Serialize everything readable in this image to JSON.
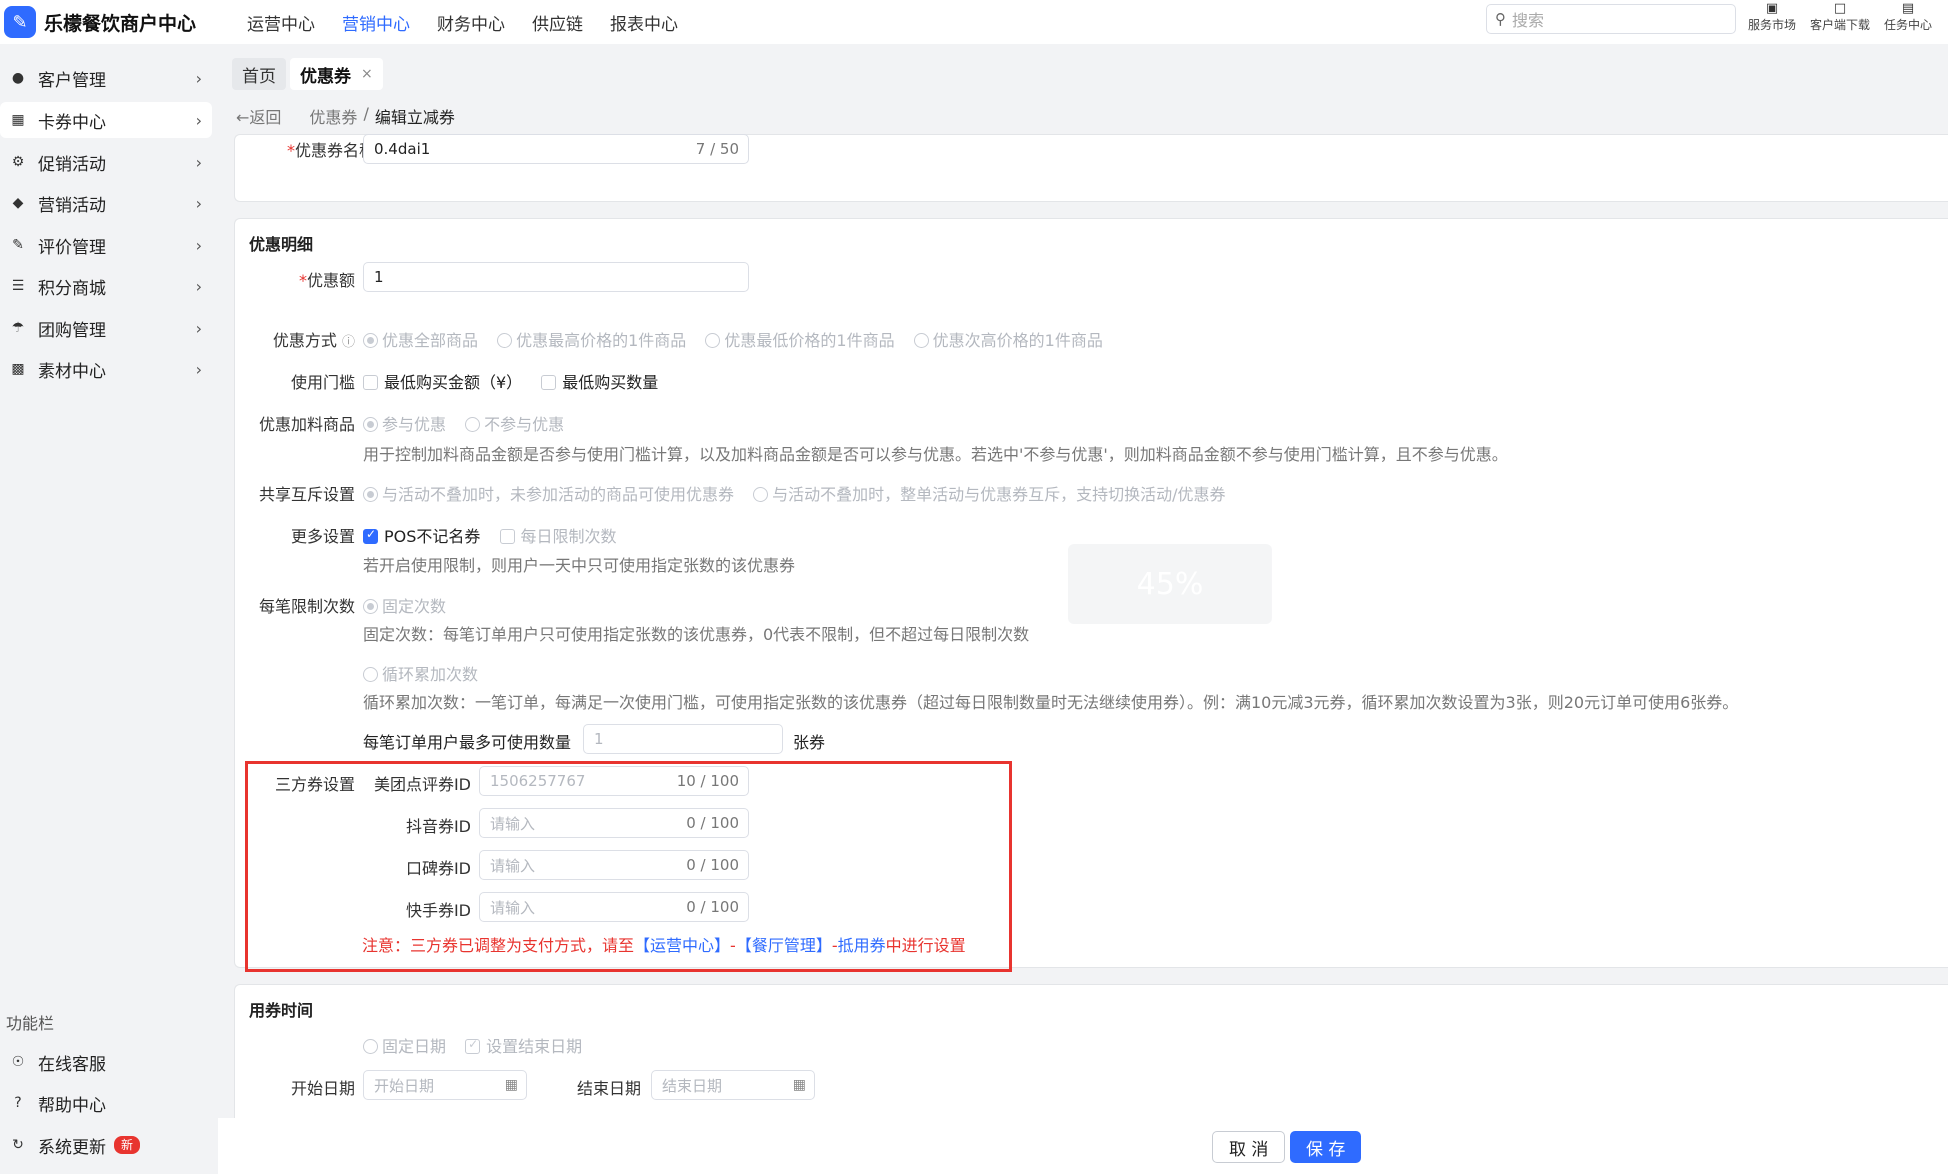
{
  "app": {
    "logo_glyph": "✎",
    "title": "乐檬餐饮商户中心"
  },
  "topnav": [
    "运营中心",
    "营销中心",
    "财务中心",
    "供应链",
    "报表中心"
  ],
  "search": {
    "placeholder": "搜索",
    "icon": "search-icon"
  },
  "tools": [
    {
      "label": "服务市场",
      "icon": "store-icon"
    },
    {
      "label": "客户端下载",
      "icon": "download-icon"
    },
    {
      "label": "任务中心",
      "icon": "task-icon"
    }
  ],
  "sidebar": {
    "items": [
      {
        "label": "客户管理",
        "icon": "user-icon"
      },
      {
        "label": "卡券中心",
        "icon": "card-icon"
      },
      {
        "label": "促销活动",
        "icon": "gear-icon"
      },
      {
        "label": "营销活动",
        "icon": "tag-icon"
      },
      {
        "label": "评价管理",
        "icon": "edit-icon"
      },
      {
        "label": "积分商城",
        "icon": "coins-icon"
      },
      {
        "label": "团购管理",
        "icon": "shop-icon"
      },
      {
        "label": "素材中心",
        "icon": "image-icon"
      }
    ],
    "func_label": "功能栏",
    "func_items": [
      {
        "label": "在线客服",
        "icon": "headset-icon"
      },
      {
        "label": "帮助中心",
        "icon": "help-icon"
      },
      {
        "label": "系统更新",
        "icon": "refresh-icon",
        "badge": "新"
      }
    ]
  },
  "tabs": [
    {
      "label": "首页"
    },
    {
      "label": "优惠券",
      "close": "×"
    }
  ],
  "breadcrumb": {
    "back": "返回",
    "parent": "优惠券",
    "sep": "/",
    "current": "编辑立减券"
  },
  "basic": {
    "name_label": "优惠券名称",
    "name_value": "0.4dai1",
    "name_count": "7 / 50"
  },
  "detail": {
    "title": "优惠明细",
    "amount_label": "优惠额",
    "amount_value": "1",
    "method_label": "优惠方式",
    "method_options": [
      "优惠全部商品",
      "优惠最高价格的1件商品",
      "优惠最低价格的1件商品",
      "优惠次高价格的1件商品"
    ],
    "threshold_label": "使用门槛",
    "threshold_options": [
      "最低购买金额（¥）",
      "最低购买数量"
    ],
    "addon_label": "优惠加料商品",
    "addon_options": [
      "参与优惠",
      "不参与优惠"
    ],
    "addon_help": "用于控制加料商品金额是否参与使用门槛计算，以及加料商品金额是否可以参与优惠。若选中'不参与优惠'，则加料商品金额不参与使用门槛计算，且不参与优惠。",
    "share_label": "共享互斥设置",
    "share_options": [
      "与活动不叠加时，未参加活动的商品可使用优惠券",
      "与活动不叠加时，整单活动与优惠券互斥，支持切换活动/优惠券"
    ],
    "more_label": "更多设置",
    "more_options": [
      "POS不记名券",
      "每日限制次数"
    ],
    "more_help": "若开启使用限制，则用户一天中只可使用指定张数的该优惠券",
    "limit_label": "每笔限制次数",
    "limit_fixed": "固定次数",
    "limit_fixed_help": "固定次数：每笔订单用户只可使用指定张数的该优惠券，0代表不限制，但不超过每日限制次数",
    "limit_loop": "循环累加次数",
    "limit_loop_help": "循环累加次数：一笔订单，每满足一次使用门槛，可使用指定张数的该优惠券（超过每日限制数量时无法继续使用券）。例：满10元减3元券，循环累加次数设置为3张，则20元订单可使用6张券。",
    "max_label": "每笔订单用户最多可使用数量",
    "max_value": "1",
    "max_unit": "张券",
    "third_label": "三方券设置",
    "third_fields": [
      {
        "label": "美团点评券ID",
        "value": "1506257767",
        "count": "10 / 100"
      },
      {
        "label": "抖音券ID",
        "placeholder": "请输入",
        "count": "0 / 100"
      },
      {
        "label": "口碑券ID",
        "placeholder": "请输入",
        "count": "0 / 100"
      },
      {
        "label": "快手券ID",
        "placeholder": "请输入",
        "count": "0 / 100"
      }
    ],
    "note_prefix": "注意：三方券已调整为支付方式，请至",
    "note_link1": "【运营中心】",
    "note_sep": "-",
    "note_link2": "【餐厅管理】",
    "note_mid": "-",
    "note_link3": "抵用券",
    "note_suffix": "中进行设置"
  },
  "watermark": "45%",
  "usetime": {
    "title": "用券时间",
    "options": [
      "固定日期",
      "设置结束日期"
    ],
    "start_label": "开始日期",
    "start_placeholder": "开始日期",
    "end_label": "结束日期",
    "end_placeholder": "结束日期"
  },
  "footer": {
    "cancel": "取 消",
    "save": "保 存"
  },
  "colors": {
    "primary": "#2f6bff",
    "danger": "#e8342f"
  }
}
